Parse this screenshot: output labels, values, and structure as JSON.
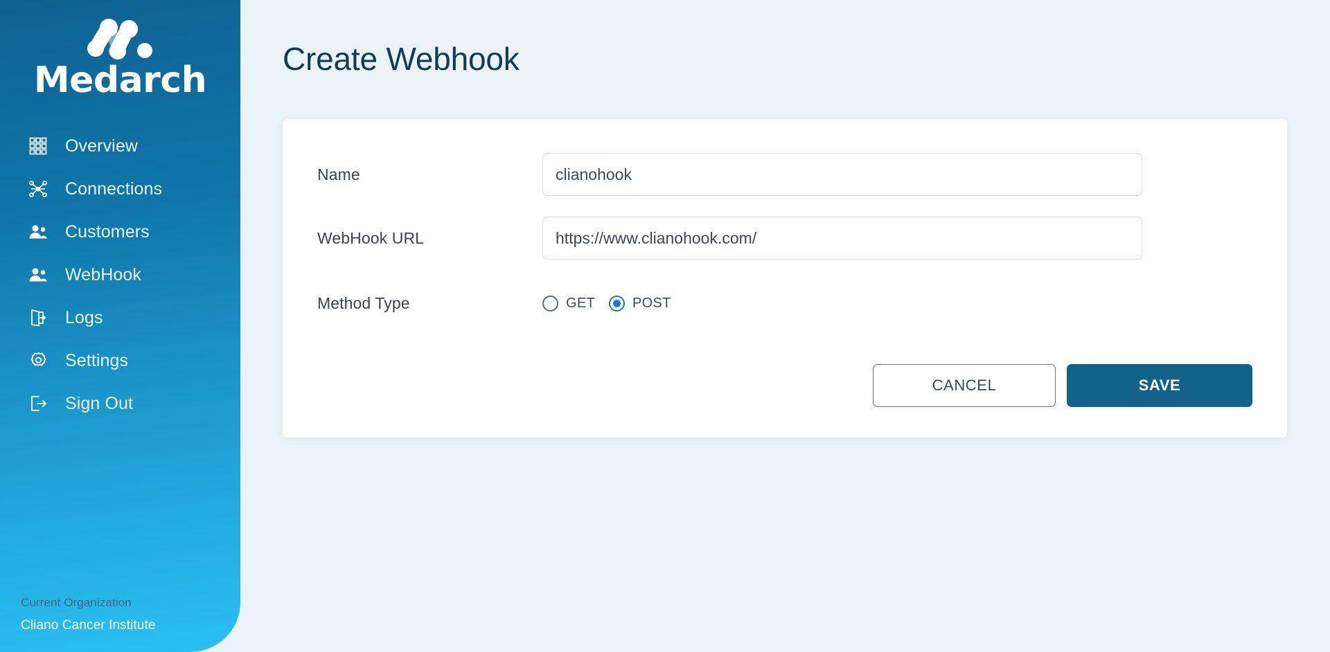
{
  "brand": {
    "name": "Medarch",
    "logo_icon": "medarch-molecule-logo"
  },
  "sidebar": {
    "items": [
      {
        "label": "Overview",
        "icon": "grid-icon"
      },
      {
        "label": "Connections",
        "icon": "network-nodes-icon"
      },
      {
        "label": "Customers",
        "icon": "users-icon"
      },
      {
        "label": "WebHook",
        "icon": "users-icon"
      },
      {
        "label": "Logs",
        "icon": "door-exit-icon"
      },
      {
        "label": "Settings",
        "icon": "gear-icon"
      },
      {
        "label": "Sign Out",
        "icon": "sign-out-icon"
      }
    ],
    "org_caption": "Current Organization",
    "org_name": "Cliano Cancer Institute"
  },
  "page": {
    "title": "Create Webhook"
  },
  "form": {
    "name": {
      "label": "Name",
      "value": "clianohook",
      "placeholder": "Name"
    },
    "url": {
      "label": "WebHook URL",
      "value": "https://www.clianohook.com/",
      "placeholder": "WebHook URL"
    },
    "method": {
      "label": "Method Type",
      "options": [
        {
          "label": "GET",
          "selected": false
        },
        {
          "label": "POST",
          "selected": true
        }
      ],
      "selected": "POST"
    }
  },
  "actions": {
    "cancel_label": "CANCEL",
    "save_label": "SAVE"
  },
  "colors": {
    "sidebar_top": "#0e6292",
    "sidebar_bottom": "#2ac0f2",
    "page_background": "#eaf4f8",
    "primary_button": "#126289",
    "radio_accent": "#1678d9",
    "title_text": "#123c50"
  }
}
